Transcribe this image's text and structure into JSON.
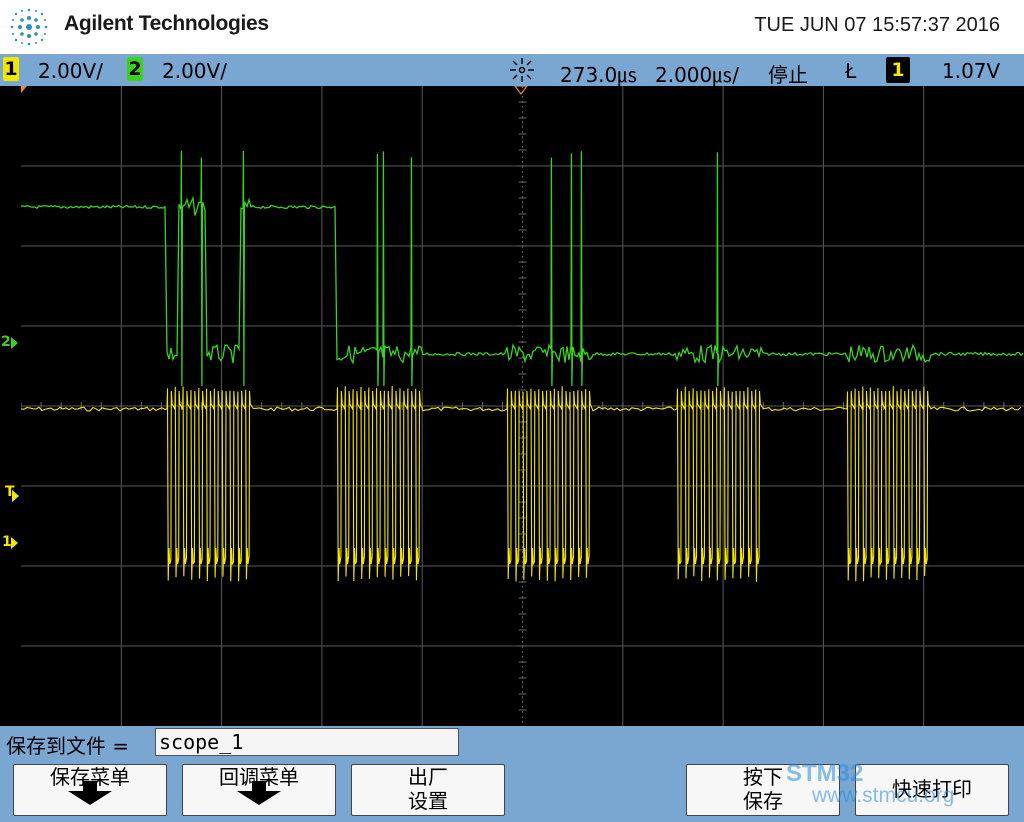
{
  "header": {
    "brand": "Agilent Technologies",
    "datetime": "TUE JUN 07 15:57:37 2016"
  },
  "status": {
    "ch1_num": "1",
    "ch1_scale": "2.00V/",
    "ch2_num": "2",
    "ch2_scale": "2.00V/",
    "delay": "273.0㎲",
    "timebase": "2.000㎲/",
    "run_state": "停止",
    "trigger_slope": "Ł",
    "trigger_source": "1",
    "trigger_level": "1.07V"
  },
  "markers": {
    "ch2_ground": "2",
    "trigger": "T",
    "ch1_ground": "1"
  },
  "file": {
    "label": "保存到文件 =",
    "value": "scope_1"
  },
  "softkeys": {
    "save_menu": "保存菜单",
    "recall_menu": "回调菜单",
    "factory_line1": "出厂",
    "factory_line2": "设置",
    "press_line1": "按下",
    "press_line2": "保存",
    "quick_print": "快速打印"
  },
  "watermark": {
    "line1": "STM32",
    "line2": "www.stmcu.org"
  },
  "colors": {
    "ch1": "#f3e600",
    "ch2": "#39d31f",
    "grid": "#5a5a5a",
    "bars": "#7aa6d2"
  }
}
